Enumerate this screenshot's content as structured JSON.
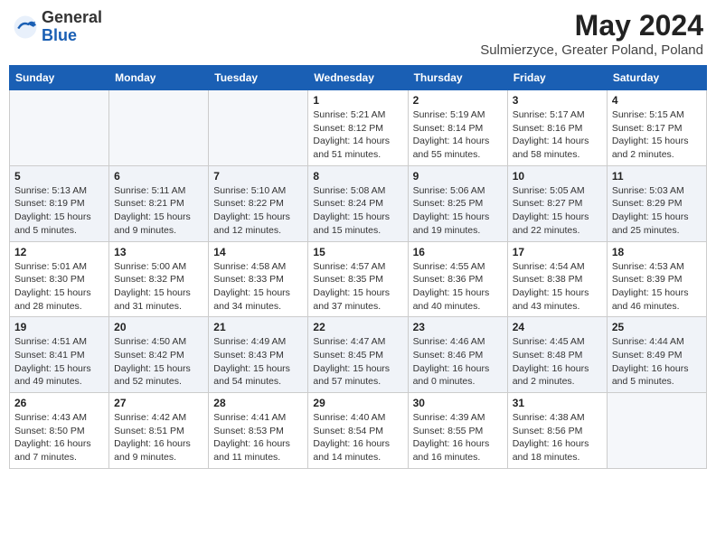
{
  "header": {
    "logo_general": "General",
    "logo_blue": "Blue",
    "month_year": "May 2024",
    "location": "Sulmierzyce, Greater Poland, Poland"
  },
  "weekdays": [
    "Sunday",
    "Monday",
    "Tuesday",
    "Wednesday",
    "Thursday",
    "Friday",
    "Saturday"
  ],
  "weeks": [
    [
      {
        "day": "",
        "info": ""
      },
      {
        "day": "",
        "info": ""
      },
      {
        "day": "",
        "info": ""
      },
      {
        "day": "1",
        "info": "Sunrise: 5:21 AM\nSunset: 8:12 PM\nDaylight: 14 hours\nand 51 minutes."
      },
      {
        "day": "2",
        "info": "Sunrise: 5:19 AM\nSunset: 8:14 PM\nDaylight: 14 hours\nand 55 minutes."
      },
      {
        "day": "3",
        "info": "Sunrise: 5:17 AM\nSunset: 8:16 PM\nDaylight: 14 hours\nand 58 minutes."
      },
      {
        "day": "4",
        "info": "Sunrise: 5:15 AM\nSunset: 8:17 PM\nDaylight: 15 hours\nand 2 minutes."
      }
    ],
    [
      {
        "day": "5",
        "info": "Sunrise: 5:13 AM\nSunset: 8:19 PM\nDaylight: 15 hours\nand 5 minutes."
      },
      {
        "day": "6",
        "info": "Sunrise: 5:11 AM\nSunset: 8:21 PM\nDaylight: 15 hours\nand 9 minutes."
      },
      {
        "day": "7",
        "info": "Sunrise: 5:10 AM\nSunset: 8:22 PM\nDaylight: 15 hours\nand 12 minutes."
      },
      {
        "day": "8",
        "info": "Sunrise: 5:08 AM\nSunset: 8:24 PM\nDaylight: 15 hours\nand 15 minutes."
      },
      {
        "day": "9",
        "info": "Sunrise: 5:06 AM\nSunset: 8:25 PM\nDaylight: 15 hours\nand 19 minutes."
      },
      {
        "day": "10",
        "info": "Sunrise: 5:05 AM\nSunset: 8:27 PM\nDaylight: 15 hours\nand 22 minutes."
      },
      {
        "day": "11",
        "info": "Sunrise: 5:03 AM\nSunset: 8:29 PM\nDaylight: 15 hours\nand 25 minutes."
      }
    ],
    [
      {
        "day": "12",
        "info": "Sunrise: 5:01 AM\nSunset: 8:30 PM\nDaylight: 15 hours\nand 28 minutes."
      },
      {
        "day": "13",
        "info": "Sunrise: 5:00 AM\nSunset: 8:32 PM\nDaylight: 15 hours\nand 31 minutes."
      },
      {
        "day": "14",
        "info": "Sunrise: 4:58 AM\nSunset: 8:33 PM\nDaylight: 15 hours\nand 34 minutes."
      },
      {
        "day": "15",
        "info": "Sunrise: 4:57 AM\nSunset: 8:35 PM\nDaylight: 15 hours\nand 37 minutes."
      },
      {
        "day": "16",
        "info": "Sunrise: 4:55 AM\nSunset: 8:36 PM\nDaylight: 15 hours\nand 40 minutes."
      },
      {
        "day": "17",
        "info": "Sunrise: 4:54 AM\nSunset: 8:38 PM\nDaylight: 15 hours\nand 43 minutes."
      },
      {
        "day": "18",
        "info": "Sunrise: 4:53 AM\nSunset: 8:39 PM\nDaylight: 15 hours\nand 46 minutes."
      }
    ],
    [
      {
        "day": "19",
        "info": "Sunrise: 4:51 AM\nSunset: 8:41 PM\nDaylight: 15 hours\nand 49 minutes."
      },
      {
        "day": "20",
        "info": "Sunrise: 4:50 AM\nSunset: 8:42 PM\nDaylight: 15 hours\nand 52 minutes."
      },
      {
        "day": "21",
        "info": "Sunrise: 4:49 AM\nSunset: 8:43 PM\nDaylight: 15 hours\nand 54 minutes."
      },
      {
        "day": "22",
        "info": "Sunrise: 4:47 AM\nSunset: 8:45 PM\nDaylight: 15 hours\nand 57 minutes."
      },
      {
        "day": "23",
        "info": "Sunrise: 4:46 AM\nSunset: 8:46 PM\nDaylight: 16 hours\nand 0 minutes."
      },
      {
        "day": "24",
        "info": "Sunrise: 4:45 AM\nSunset: 8:48 PM\nDaylight: 16 hours\nand 2 minutes."
      },
      {
        "day": "25",
        "info": "Sunrise: 4:44 AM\nSunset: 8:49 PM\nDaylight: 16 hours\nand 5 minutes."
      }
    ],
    [
      {
        "day": "26",
        "info": "Sunrise: 4:43 AM\nSunset: 8:50 PM\nDaylight: 16 hours\nand 7 minutes."
      },
      {
        "day": "27",
        "info": "Sunrise: 4:42 AM\nSunset: 8:51 PM\nDaylight: 16 hours\nand 9 minutes."
      },
      {
        "day": "28",
        "info": "Sunrise: 4:41 AM\nSunset: 8:53 PM\nDaylight: 16 hours\nand 11 minutes."
      },
      {
        "day": "29",
        "info": "Sunrise: 4:40 AM\nSunset: 8:54 PM\nDaylight: 16 hours\nand 14 minutes."
      },
      {
        "day": "30",
        "info": "Sunrise: 4:39 AM\nSunset: 8:55 PM\nDaylight: 16 hours\nand 16 minutes."
      },
      {
        "day": "31",
        "info": "Sunrise: 4:38 AM\nSunset: 8:56 PM\nDaylight: 16 hours\nand 18 minutes."
      },
      {
        "day": "",
        "info": ""
      }
    ]
  ]
}
